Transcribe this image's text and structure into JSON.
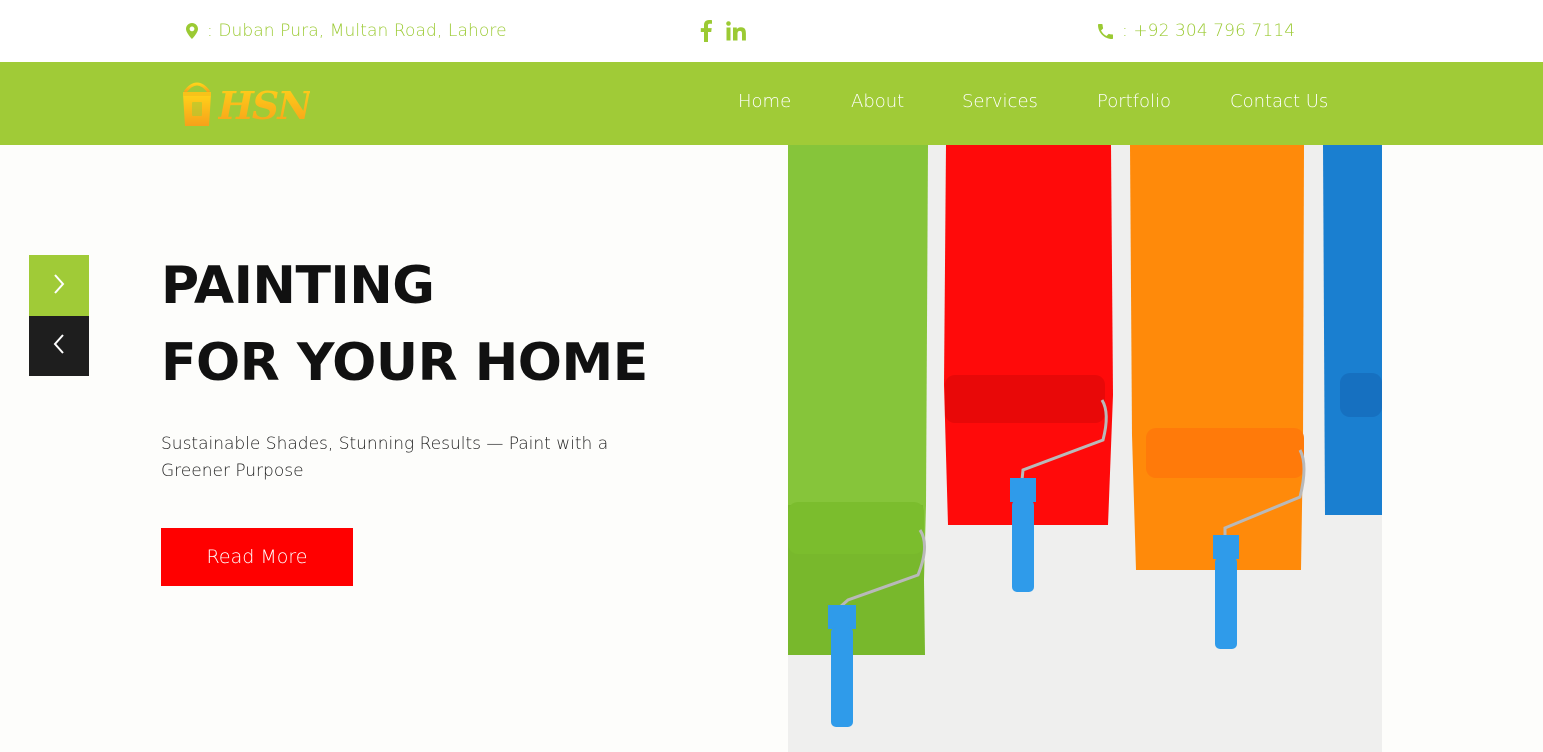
{
  "topbar": {
    "address": ": Duban Pura, Multan Road, Lahore",
    "phone": ": +92 304 796 7114",
    "social": [
      "facebook-icon",
      "linkedin-icon"
    ],
    "icons": {
      "address": "map-pin-icon",
      "phone": "phone-icon"
    }
  },
  "brand": {
    "logo_text": "HSN",
    "logo_icon": "paint-bucket-icon"
  },
  "nav": {
    "items": [
      "Home",
      "About",
      "Services",
      "Portfolio",
      "Contact Us"
    ]
  },
  "hero": {
    "headline_line1": "PAINTING",
    "headline_line2": "FOR YOUR HOME",
    "subtitle": "Sustainable Shades, Stunning Results — Paint with a Greener Purpose",
    "cta": "Read More",
    "next_icon": "chevron-right-icon",
    "prev_icon": "chevron-left-icon",
    "image": "paint-rollers-on-wall-image"
  },
  "colors": {
    "brand_green": "#a0cb37",
    "topbar_text": "#9bca33",
    "cta_red": "#ff0000",
    "dark": "#1e1e1e",
    "paint_green": "#86c53a",
    "paint_red": "#ff0a0a",
    "paint_orange": "#ff8a0a",
    "paint_blue": "#1a7fd0",
    "roller_blue": "#2f9bea"
  }
}
